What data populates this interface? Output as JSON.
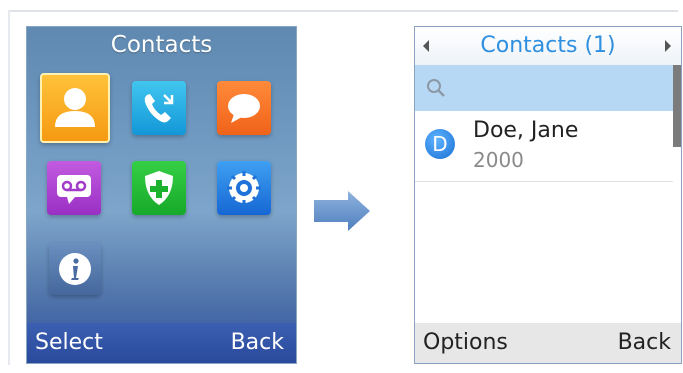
{
  "left_screen": {
    "title": "Contacts",
    "apps": [
      {
        "name": "contacts",
        "icon": "contacts-icon",
        "selected": true
      },
      {
        "name": "calls",
        "icon": "calls-icon"
      },
      {
        "name": "messages",
        "icon": "messages-icon"
      },
      {
        "name": "voicemail",
        "icon": "voicemail-icon"
      },
      {
        "name": "security",
        "icon": "shield-plus-icon"
      },
      {
        "name": "settings",
        "icon": "gear-icon"
      },
      {
        "name": "info",
        "icon": "info-icon"
      }
    ],
    "softkeys": {
      "left": "Select",
      "right": "Back"
    }
  },
  "right_screen": {
    "title": "Contacts (1)",
    "contact": {
      "initial": "D",
      "name": "Doe, Jane",
      "number": "2000"
    },
    "softkeys": {
      "left": "Options",
      "right": "Back"
    }
  },
  "colors": {
    "title_blue": "#2f8fe0",
    "search_highlight": "#b7d8f4",
    "softbar_left": "#2a4a9c"
  }
}
